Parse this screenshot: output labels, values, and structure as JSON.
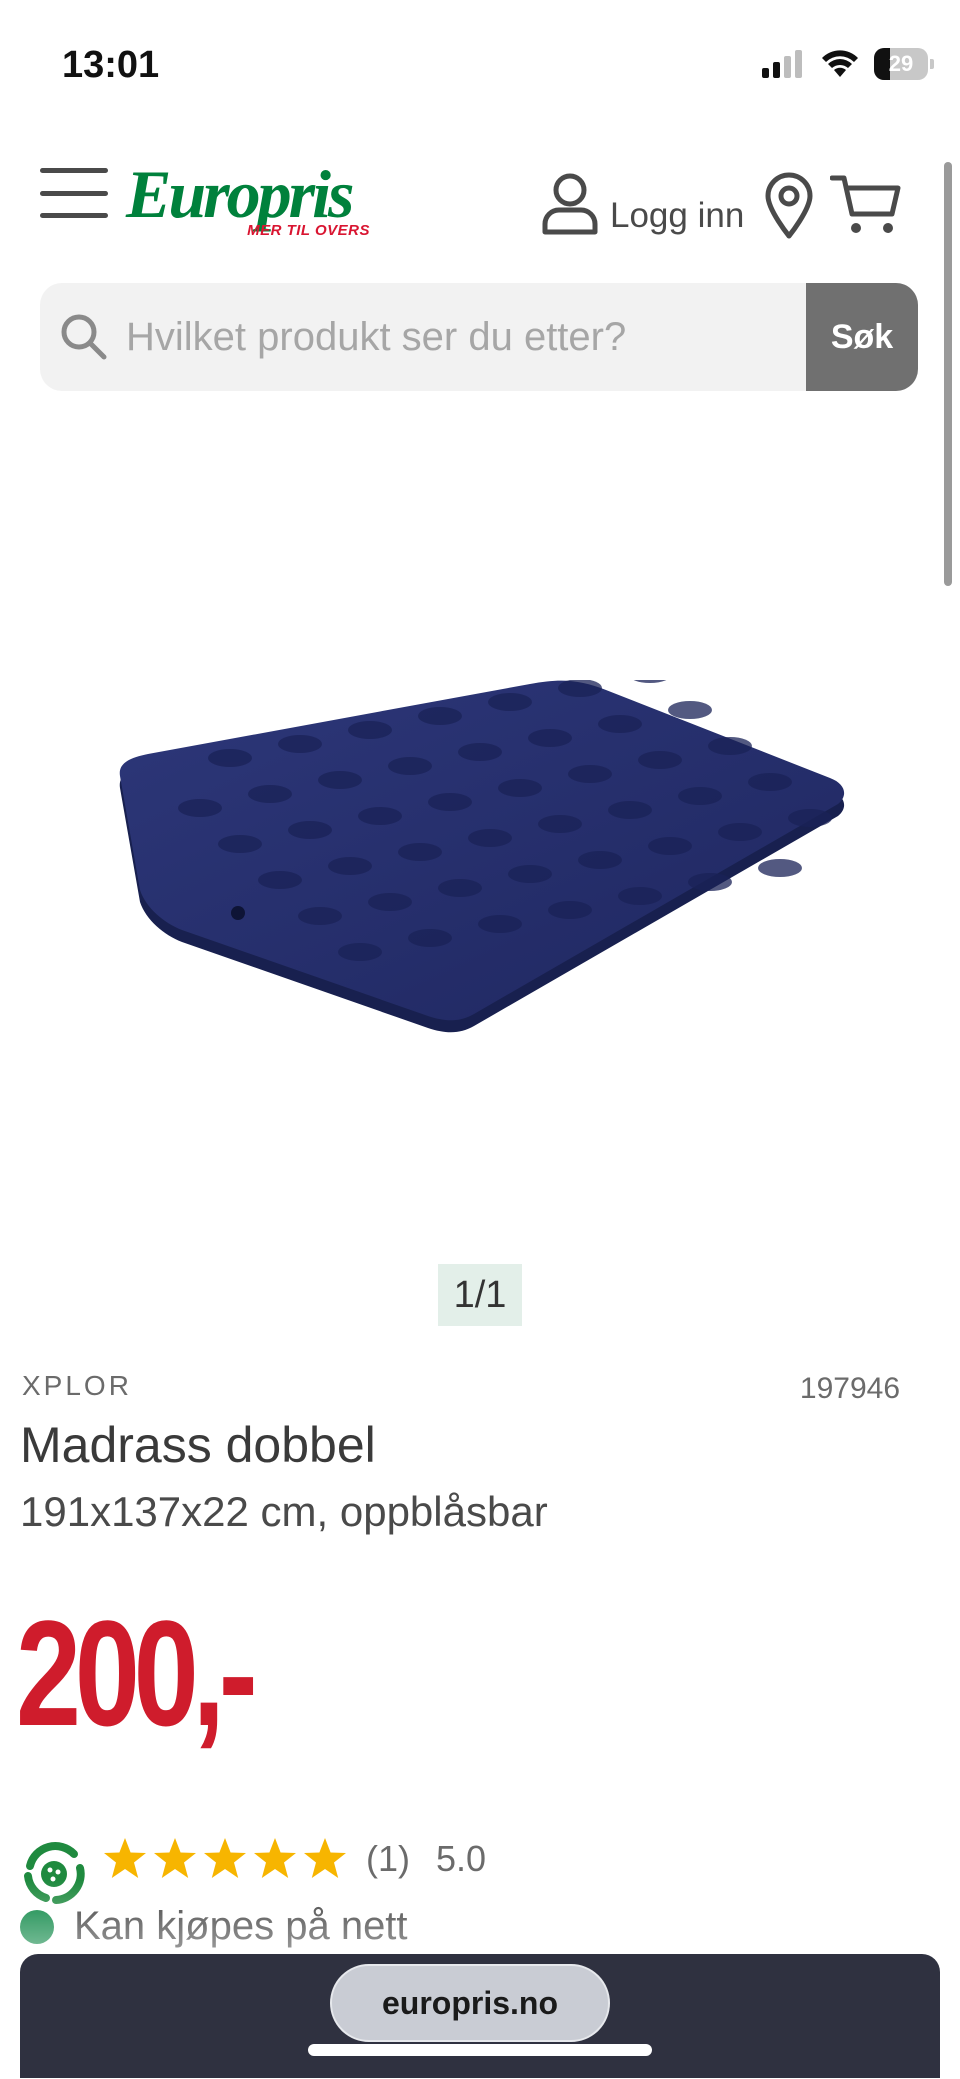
{
  "status_bar": {
    "time": "13:01",
    "battery": "29",
    "battery_level": 0.29
  },
  "header": {
    "logo": {
      "name": "Europris",
      "tagline": "MER TIL OVERS"
    },
    "login_label": "Logg inn",
    "icons": [
      "menu-icon",
      "user-icon",
      "location-pin-icon",
      "cart-icon"
    ]
  },
  "search": {
    "placeholder": "Hvilket produkt ser du etter?",
    "value": "",
    "button_label": "Søk"
  },
  "gallery": {
    "counter": "1/1"
  },
  "product": {
    "brand": "XPLOR",
    "sku": "197946",
    "title": "Madrass dobbel",
    "subtitle": "191x137x22 cm, oppblåsbar",
    "price": "200,-",
    "rating": {
      "stars": 5,
      "review_count": "(1)",
      "average": "5.0"
    },
    "availability": "Kan kjøpes på nett"
  },
  "browser": {
    "url": "europris.no"
  },
  "colors": {
    "brand_green": "#00813c",
    "price_red": "#cf1c2c",
    "star_yellow": "#f7b500",
    "search_button": "#707070",
    "browser_bar": "#2f3140"
  }
}
